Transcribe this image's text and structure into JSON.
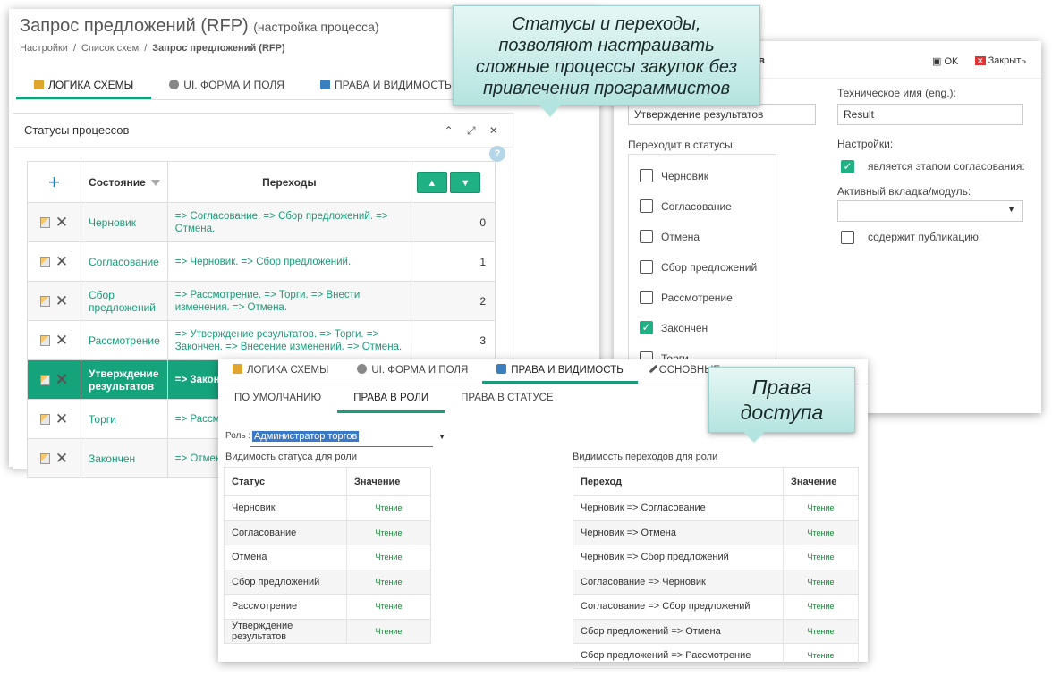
{
  "w1": {
    "title": "Запрос предложений (RFP)",
    "title_sub": "(настройка процесса)",
    "crumbs": [
      "Настройки",
      "/",
      "Список схем",
      "/"
    ],
    "crumb_current": "Запрос предложений (RFP)",
    "tabs": [
      "ЛОГИКА СХЕМЫ",
      "UI. ФОРМА И ПОЛЯ",
      "ПРАВА И ВИДИМОСТЬ"
    ],
    "panel_title": "Статусы процессов",
    "panel_controls": "⌃ ⤢ ✕",
    "help": "?",
    "add": "+",
    "columns": {
      "state": "Состояние",
      "trans": "Переходы"
    },
    "rows": [
      {
        "state": "Черновик",
        "trans": "=> Согласование. => Сбор предложений. => Отмена.",
        "num": "0"
      },
      {
        "state": "Согласование",
        "trans": "=> Черновик. => Сбор предложений.",
        "num": "1"
      },
      {
        "state": "Сбор предложений",
        "trans": "=> Рассмотрение. => Торги. => Внести изменения. => Отмена.",
        "num": "2"
      },
      {
        "state": "Рассмотрение",
        "trans": "=> Утверждение результатов. => Торги. => Закончен. => Внесение изменений. => Отмена.",
        "num": "3"
      },
      {
        "state": "Утверждение результатов",
        "trans": "=> Закон",
        "num": ""
      },
      {
        "state": "Торги",
        "trans": "=> Рассм результ",
        "num": ""
      },
      {
        "state": "Закончен",
        "trans": "=> Отмен",
        "num": ""
      }
    ]
  },
  "w2": {
    "header_fragment": "атов",
    "ok": "OK",
    "close": "Закрыть",
    "name_value": "Утверждение результатов",
    "tech_label": "Техническое имя (eng.):",
    "tech_value": "Result",
    "goes_to_label": "Переходит в статусы:",
    "settings_label": "Настройки:",
    "is_approval": "является этапом согласования:",
    "active_tab_label": "Активный вкладка/модуль:",
    "has_publication": "содержит публикацию:",
    "statuses": [
      {
        "label": "Черновик",
        "checked": false
      },
      {
        "label": "Согласование",
        "checked": false
      },
      {
        "label": "Отмена",
        "checked": false
      },
      {
        "label": "Сбор предложений",
        "checked": false
      },
      {
        "label": "Рассмотрение",
        "checked": false
      },
      {
        "label": "Закончен",
        "checked": true
      },
      {
        "label": "Торги",
        "checked": false
      }
    ]
  },
  "w3": {
    "tabs": [
      "ЛОГИКА СХЕМЫ",
      "UI. ФОРМА И ПОЛЯ",
      "ПРАВА И ВИДИМОСТЬ",
      "ОСНОВНЫЕ"
    ],
    "subtabs": [
      "ПО УМОЛЧАНИЮ",
      "ПРАВА В РОЛИ",
      "ПРАВА В СТАТУСЕ"
    ],
    "role_label": "Роль :",
    "role_value": "Администратор торгов",
    "left_title": "Видимость статуса для роли",
    "right_title": "Видимость переходов для роли",
    "left_cols": [
      "Статус",
      "Значение"
    ],
    "right_cols": [
      "Переход",
      "Значение"
    ],
    "left_rows": [
      [
        "Черновик",
        "Чтение"
      ],
      [
        "Согласование",
        "Чтение"
      ],
      [
        "Отмена",
        "Чтение"
      ],
      [
        "Сбор предложений",
        "Чтение"
      ],
      [
        "Рассмотрение",
        "Чтение"
      ],
      [
        "Утверждение результатов",
        "Чтение"
      ]
    ],
    "right_rows": [
      [
        "Черновик => Согласование",
        "Чтение"
      ],
      [
        "Черновик => Отмена",
        "Чтение"
      ],
      [
        "Черновик => Сбор предложений",
        "Чтение"
      ],
      [
        "Согласование => Черновик",
        "Чтение"
      ],
      [
        "Согласование => Сбор предложений",
        "Чтение"
      ],
      [
        "Сбор предложений => Отмена",
        "Чтение"
      ],
      [
        "Сбор предложений => Рассмотрение",
        "Чтение"
      ]
    ]
  },
  "callouts": {
    "c1": [
      "Статусы и переходы,",
      "позволяют настраивать",
      "сложные процессы закупок без",
      "привлечения программистов"
    ],
    "c2": [
      "Права",
      "доступа"
    ]
  },
  "colors": {
    "accent": "#1a9b7a",
    "selected_row": "#15a37c",
    "callout": "#b4e4df"
  }
}
